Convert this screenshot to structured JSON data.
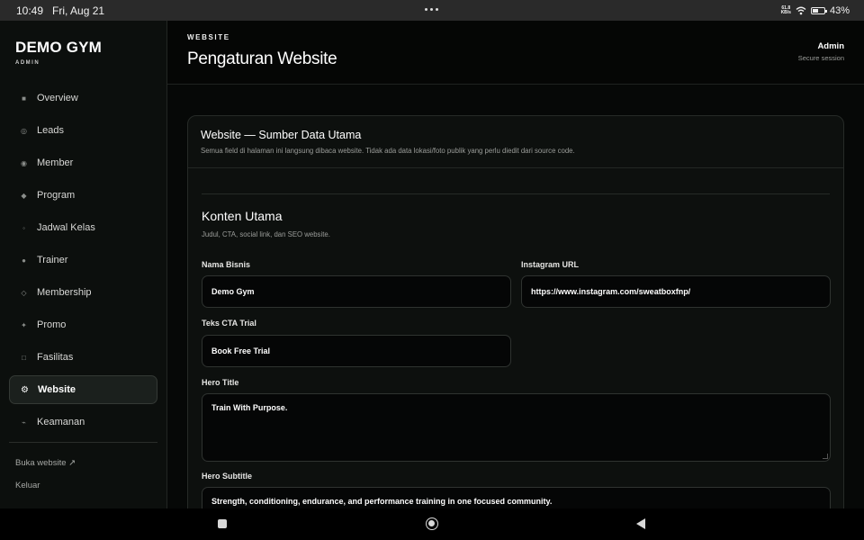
{
  "status_bar": {
    "time": "10:49",
    "date": "Fri, Aug 21",
    "net_speed_value": "61.8",
    "net_speed_unit": "KB/s",
    "battery": "43%",
    "icons": [
      "wifi-icon",
      "battery-icon"
    ]
  },
  "sidebar": {
    "brand": "DEMO GYM",
    "brand_sub": "ADMIN",
    "items": [
      {
        "label": "Overview",
        "icon": "■",
        "active": false
      },
      {
        "label": "Leads",
        "icon": "◎",
        "active": false
      },
      {
        "label": "Member",
        "icon": "◉",
        "active": false
      },
      {
        "label": "Program",
        "icon": "◆",
        "active": false
      },
      {
        "label": "Jadwal Kelas",
        "icon": "◦",
        "active": false
      },
      {
        "label": "Trainer",
        "icon": "●",
        "active": false
      },
      {
        "label": "Membership",
        "icon": "◇",
        "active": false
      },
      {
        "label": "Promo",
        "icon": "✦",
        "active": false
      },
      {
        "label": "Fasilitas",
        "icon": "□",
        "active": false
      },
      {
        "label": "Website",
        "icon": "⚙",
        "active": true
      },
      {
        "label": "Keamanan",
        "icon": "⌁",
        "active": false
      }
    ],
    "open_website": "Buka website ↗",
    "logout": "Keluar"
  },
  "header": {
    "eyebrow": "WEBSITE",
    "title": "Pengaturan Website",
    "user_name": "Admin",
    "user_sub": "Secure session"
  },
  "card": {
    "title": "Website — Sumber Data Utama",
    "description": "Semua field di halaman ini langsung dibaca website. Tidak ada data lokasi/foto publik yang perlu diedit dari source code.",
    "section_title": "Konten Utama",
    "section_desc": "Judul, CTA, social link, dan SEO website.",
    "fields": {
      "business_name": {
        "label": "Nama Bisnis",
        "value": "Demo Gym"
      },
      "instagram_url": {
        "label": "Instagram URL",
        "value": "https://www.instagram.com/sweatboxfnp/"
      },
      "cta_text": {
        "label": "Teks CTA Trial",
        "value": "Book Free Trial"
      },
      "hero_title": {
        "label": "Hero Title",
        "value": "Train With Purpose."
      },
      "hero_subtitle": {
        "label": "Hero Subtitle",
        "value": "Strength, conditioning, endurance, and performance training in one focused community."
      }
    }
  }
}
